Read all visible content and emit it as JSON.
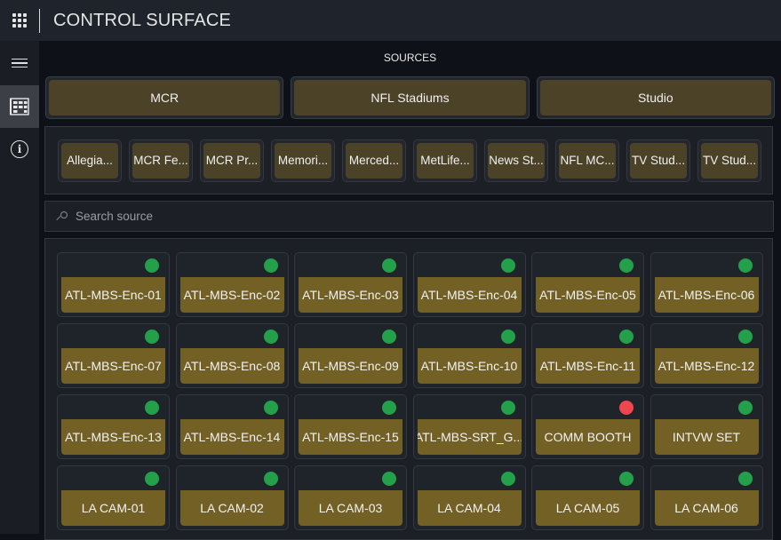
{
  "header": {
    "title": "CONTROL SURFACE",
    "apps_icon": "apps-grid-icon"
  },
  "sidebar": {
    "items": [
      {
        "name": "menu",
        "icon": "hamburger-icon",
        "active": false
      },
      {
        "name": "sources",
        "icon": "cabinet-icon",
        "active": true
      },
      {
        "name": "info",
        "icon": "info-icon",
        "active": false
      }
    ]
  },
  "main": {
    "section_label": "SOURCES",
    "categories": [
      "MCR",
      "NFL Stadiums",
      "Studio"
    ],
    "groups": [
      "Allegia...",
      "MCR Fe...",
      "MCR Pr...",
      "Memori...",
      "Merced...",
      "MetLife...",
      "News St...",
      "NFL MC...",
      "TV Stud...",
      "TV Stud..."
    ],
    "search": {
      "placeholder": "Search source",
      "value": ""
    },
    "status_colors": {
      "online": "#25a04a",
      "offline": "#f0474f"
    },
    "sources": [
      {
        "name": "ATL-MBS-Enc-01",
        "status": "online"
      },
      {
        "name": "ATL-MBS-Enc-02",
        "status": "online"
      },
      {
        "name": "ATL-MBS-Enc-03",
        "status": "online"
      },
      {
        "name": "ATL-MBS-Enc-04",
        "status": "online"
      },
      {
        "name": "ATL-MBS-Enc-05",
        "status": "online"
      },
      {
        "name": "ATL-MBS-Enc-06",
        "status": "online"
      },
      {
        "name": "ATL-MBS-Enc-07",
        "status": "online"
      },
      {
        "name": "ATL-MBS-Enc-08",
        "status": "online"
      },
      {
        "name": "ATL-MBS-Enc-09",
        "status": "online"
      },
      {
        "name": "ATL-MBS-Enc-10",
        "status": "online"
      },
      {
        "name": "ATL-MBS-Enc-11",
        "status": "online"
      },
      {
        "name": "ATL-MBS-Enc-12",
        "status": "online"
      },
      {
        "name": "ATL-MBS-Enc-13",
        "status": "online"
      },
      {
        "name": "ATL-MBS-Enc-14",
        "status": "online"
      },
      {
        "name": "ATL-MBS-Enc-15",
        "status": "online"
      },
      {
        "name": "ATL-MBS-SRT_G...",
        "status": "online"
      },
      {
        "name": "COMM BOOTH",
        "status": "offline"
      },
      {
        "name": "INTVW SET",
        "status": "online"
      },
      {
        "name": "LA CAM-01",
        "status": "online"
      },
      {
        "name": "LA CAM-02",
        "status": "online"
      },
      {
        "name": "LA CAM-03",
        "status": "online"
      },
      {
        "name": "LA CAM-04",
        "status": "online"
      },
      {
        "name": "LA CAM-05",
        "status": "online"
      },
      {
        "name": "LA CAM-06",
        "status": "online"
      }
    ]
  }
}
